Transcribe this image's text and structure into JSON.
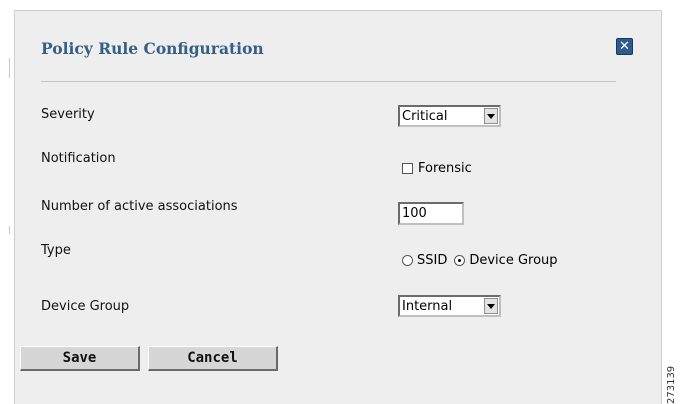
{
  "dialog": {
    "title": "Policy Rule Configuration",
    "close_icon": "close-icon",
    "accent_color": "#2f5a8e"
  },
  "form": {
    "severity": {
      "label": "Severity",
      "value": "Critical"
    },
    "notification": {
      "label": "Notification",
      "checkbox_label": "Forensic",
      "checked": false
    },
    "associations": {
      "label": "Number of active associations",
      "value": "100"
    },
    "type": {
      "label": "Type",
      "options": [
        {
          "label": "SSID",
          "selected": false
        },
        {
          "label": "Device Group",
          "selected": true
        }
      ]
    },
    "device_group": {
      "label": "Device Group",
      "value": "Internal"
    }
  },
  "buttons": {
    "save": "Save",
    "cancel": "Cancel"
  },
  "figure_id": "273139"
}
